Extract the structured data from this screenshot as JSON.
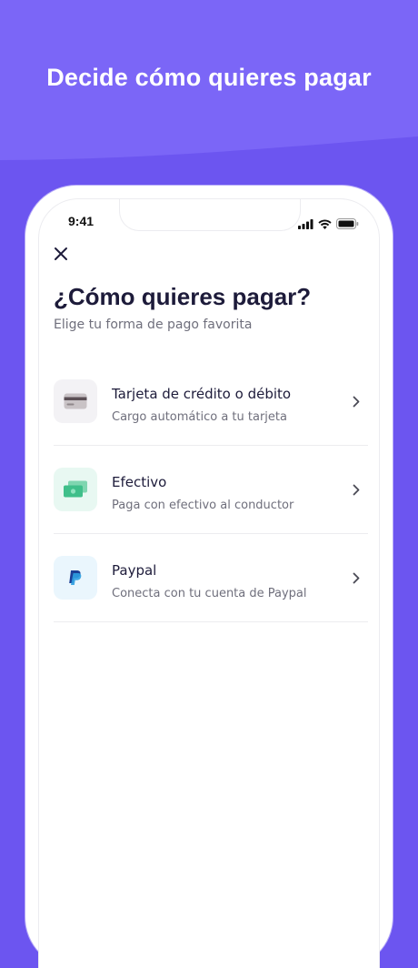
{
  "headline": "Decide cómo quieres pagar",
  "status_bar": {
    "time": "9:41"
  },
  "screen": {
    "title": "¿Cómo quieres pagar?",
    "subtitle": "Elige tu forma de pago favorita",
    "options": [
      {
        "title": "Tarjeta de crédito o débito",
        "description": "Cargo automático a tu tarjeta",
        "icon": "credit-card-icon",
        "icon_bg": "#f3f2f5"
      },
      {
        "title": "Efectivo",
        "description": "Paga con efectivo al conductor",
        "icon": "cash-icon",
        "icon_bg": "#e8f8f2"
      },
      {
        "title": "Paypal",
        "description": "Conecta con tu cuenta de Paypal",
        "icon": "paypal-icon",
        "icon_bg": "#eaf6fd"
      }
    ]
  },
  "colors": {
    "background": "#6c55f0",
    "background_top": "#7b66f7",
    "title_text": "#1d1b3a",
    "secondary_text": "#6f6f7c"
  }
}
